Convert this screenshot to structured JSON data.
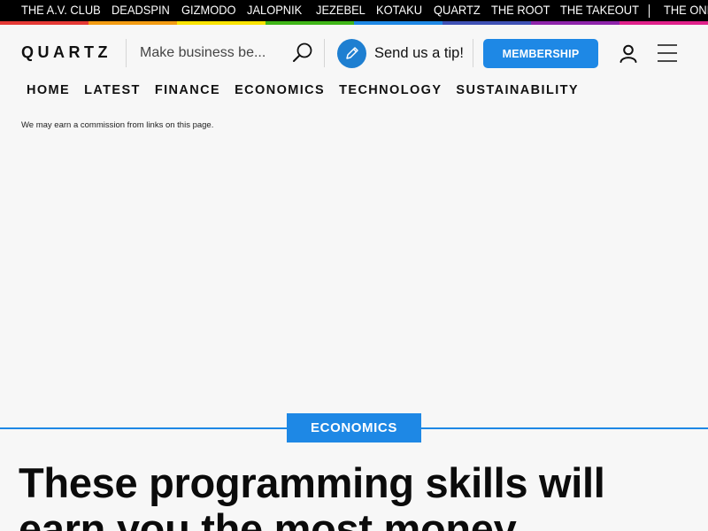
{
  "network": {
    "links": [
      "THE A.V. CLUB",
      "DEADSPIN",
      "GIZMODO",
      "JALOPNIK",
      "JEZEBEL",
      "KOTAKU",
      "QUARTZ",
      "THE ROOT",
      "THE TAKEOUT",
      "THE ONI"
    ],
    "rainbow_colors": [
      "#e53935",
      "#f39c12",
      "#f9e300",
      "#3fb618",
      "#1e88e5",
      "#3f51b5",
      "#8e24aa",
      "#e0218a"
    ]
  },
  "header": {
    "logo": "QUARTZ",
    "search_placeholder": "Make business be...",
    "tip_label": "Send us a tip!",
    "membership_label": "MEMBERSHIP",
    "icons": {
      "search": "search-icon",
      "tip": "pencil-icon",
      "account": "user-icon",
      "menu": "hamburger-menu-icon"
    }
  },
  "nav": {
    "items": [
      "HOME",
      "LATEST",
      "FINANCE",
      "ECONOMICS",
      "TECHNOLOGY",
      "SUSTAINABILITY"
    ]
  },
  "disclaimer": "We may earn a commission from links on this page.",
  "article": {
    "category": "ECONOMICS",
    "headline": "These programming skills will earn you the most money"
  },
  "colors": {
    "accent": "#1e88e5",
    "background": "#f7f7f7",
    "text": "#111111"
  }
}
